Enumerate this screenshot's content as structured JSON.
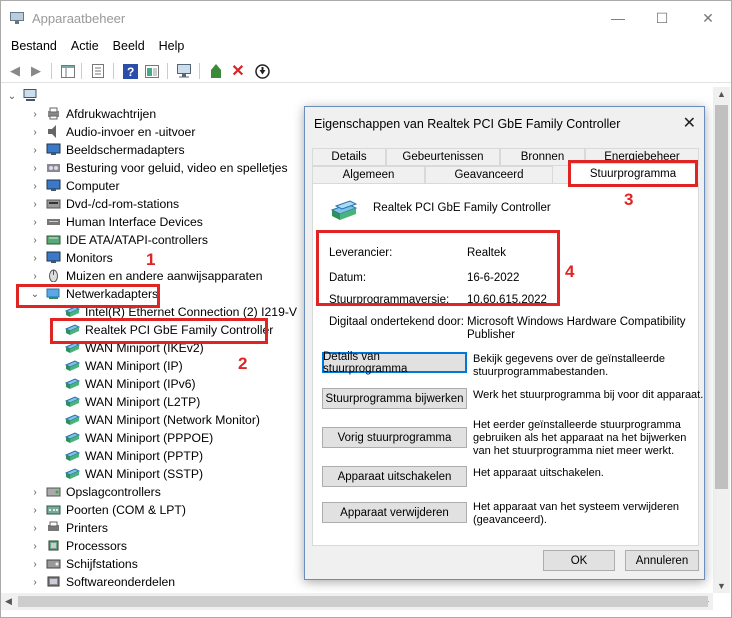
{
  "window": {
    "title": "Apparaatbeheer",
    "minimize": "—",
    "maximize": "☐",
    "close": "✕"
  },
  "menu": [
    "Bestand",
    "Actie",
    "Beeld",
    "Help"
  ],
  "tree": {
    "root_icon": "computer-icon",
    "categories": [
      {
        "label": "Afdrukwachtrijen",
        "icon": "printer-queue-icon"
      },
      {
        "label": "Audio-invoer en -uitvoer",
        "icon": "speaker-icon"
      },
      {
        "label": "Beeldschermadapters",
        "icon": "display-adapter-icon"
      },
      {
        "label": "Besturing voor geluid, video en spelletjes",
        "icon": "sound-icon"
      },
      {
        "label": "Computer",
        "icon": "monitor-icon"
      },
      {
        "label": "Dvd-/cd-rom-stations",
        "icon": "disc-icon"
      },
      {
        "label": "Human Interface Devices",
        "icon": "hid-icon"
      },
      {
        "label": "IDE ATA/ATAPI-controllers",
        "icon": "ide-icon"
      },
      {
        "label": "Monitors",
        "icon": "monitor-icon"
      },
      {
        "label": "Muizen en andere aanwijsapparaten",
        "icon": "mouse-icon"
      },
      {
        "label": "Netwerkadapters",
        "icon": "network-icon"
      }
    ],
    "network_children": [
      "Intel(R) Ethernet Connection (2) I219-V",
      "Realtek PCI GbE Family Controller",
      "WAN Miniport (IKEv2)",
      "WAN Miniport (IP)",
      "WAN Miniport (IPv6)",
      "WAN Miniport (L2TP)",
      "WAN Miniport (Network Monitor)",
      "WAN Miniport (PPPOE)",
      "WAN Miniport (PPTP)",
      "WAN Miniport (SSTP)"
    ],
    "after": [
      {
        "label": "Opslagcontrollers",
        "icon": "storage-icon"
      },
      {
        "label": "Poorten (COM & LPT)",
        "icon": "port-icon"
      },
      {
        "label": "Printers",
        "icon": "printer-icon"
      },
      {
        "label": "Processors",
        "icon": "cpu-icon"
      },
      {
        "label": "Schijfstations",
        "icon": "disk-icon"
      },
      {
        "label": "Softwareonderdelen",
        "icon": "software-icon"
      }
    ]
  },
  "dialog": {
    "title": "Eigenschappen van Realtek PCI GbE Family Controller",
    "close": "✕",
    "tabs_top": [
      "Details",
      "Gebeurtenissen",
      "Bronnen",
      "Energiebeheer"
    ],
    "tabs_bottom": [
      "Algemeen",
      "Geavanceerd",
      "Stuurprogramma"
    ],
    "device_name": "Realtek PCI GbE Family Controller",
    "fields": [
      {
        "label": "Leverancier:",
        "value": "Realtek"
      },
      {
        "label": "Datum:",
        "value": "16-6-2022"
      },
      {
        "label": "Stuurprogrammaversie:",
        "value": "10.60.615.2022"
      },
      {
        "label": "Digitaal ondertekend door:",
        "value": "Microsoft Windows Hardware Compatibility Publisher"
      }
    ],
    "actions": [
      {
        "button": "Details van stuurprogramma",
        "desc": "Bekijk gegevens over de geïnstalleerde stuurprogrammabestanden."
      },
      {
        "button": "Stuurprogramma bijwerken",
        "desc": "Werk het stuurprogramma bij voor dit apparaat."
      },
      {
        "button": "Vorig stuurprogramma",
        "desc": "Het eerder geïnstalleerde stuurprogramma gebruiken als het apparaat na het bijwerken van het stuurprogramma niet meer werkt."
      },
      {
        "button": "Apparaat uitschakelen",
        "desc": "Het apparaat uitschakelen."
      },
      {
        "button": "Apparaat verwijderen",
        "desc": "Het apparaat van het systeem verwijderen (geavanceerd)."
      }
    ],
    "ok": "OK",
    "cancel": "Annuleren"
  },
  "annotations": [
    "1",
    "2",
    "3",
    "4"
  ],
  "colors": {
    "annotation": "#e02424",
    "focus": "#0078d7"
  }
}
